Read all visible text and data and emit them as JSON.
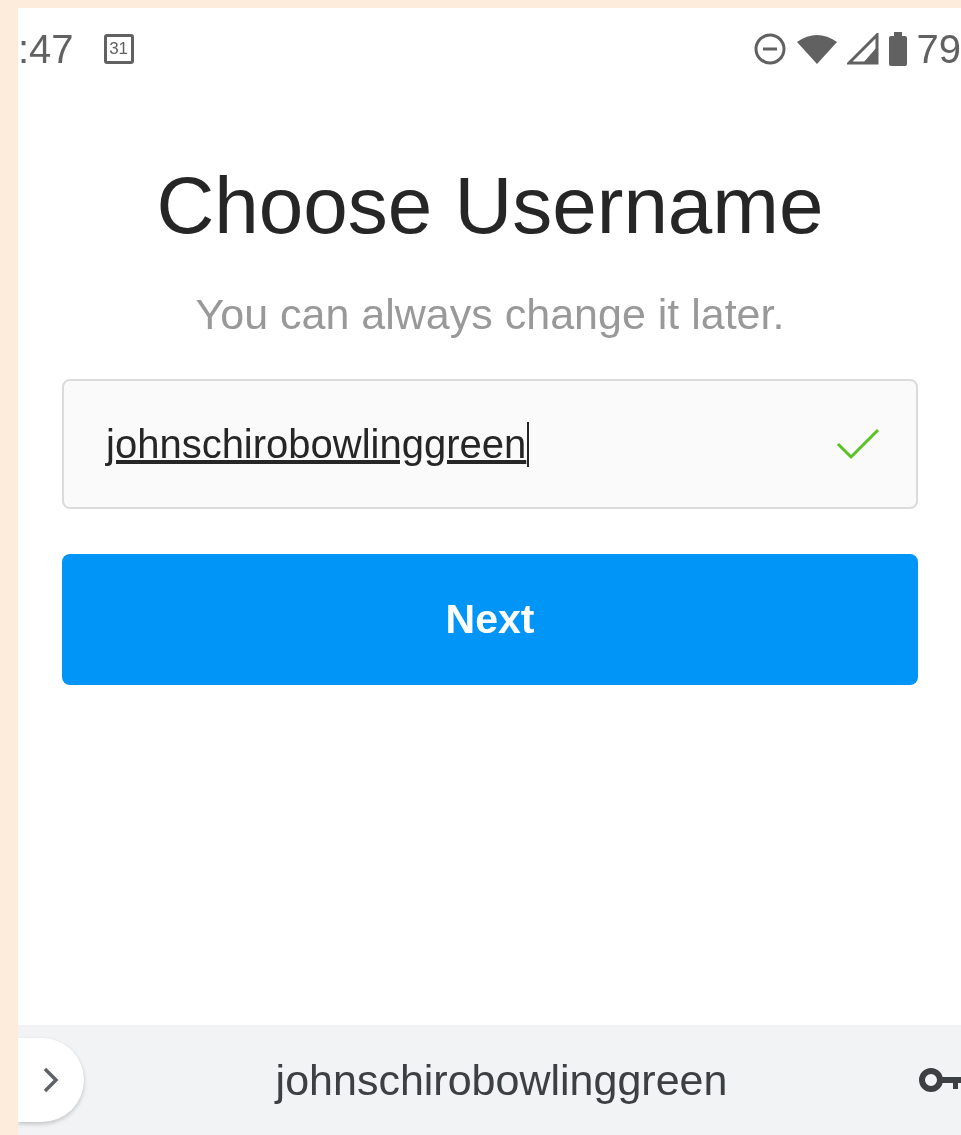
{
  "status_bar": {
    "time": ":47",
    "calendar_day": "31",
    "battery": "79"
  },
  "title": "Choose Username",
  "subtitle": "You can always change it later.",
  "username_field": {
    "value": "johnschirobowlinggreen",
    "valid": true,
    "composing": true
  },
  "next_button": {
    "label": "Next"
  },
  "suggestion_bar": {
    "suggestion": "johnschirobowlinggreen"
  }
}
